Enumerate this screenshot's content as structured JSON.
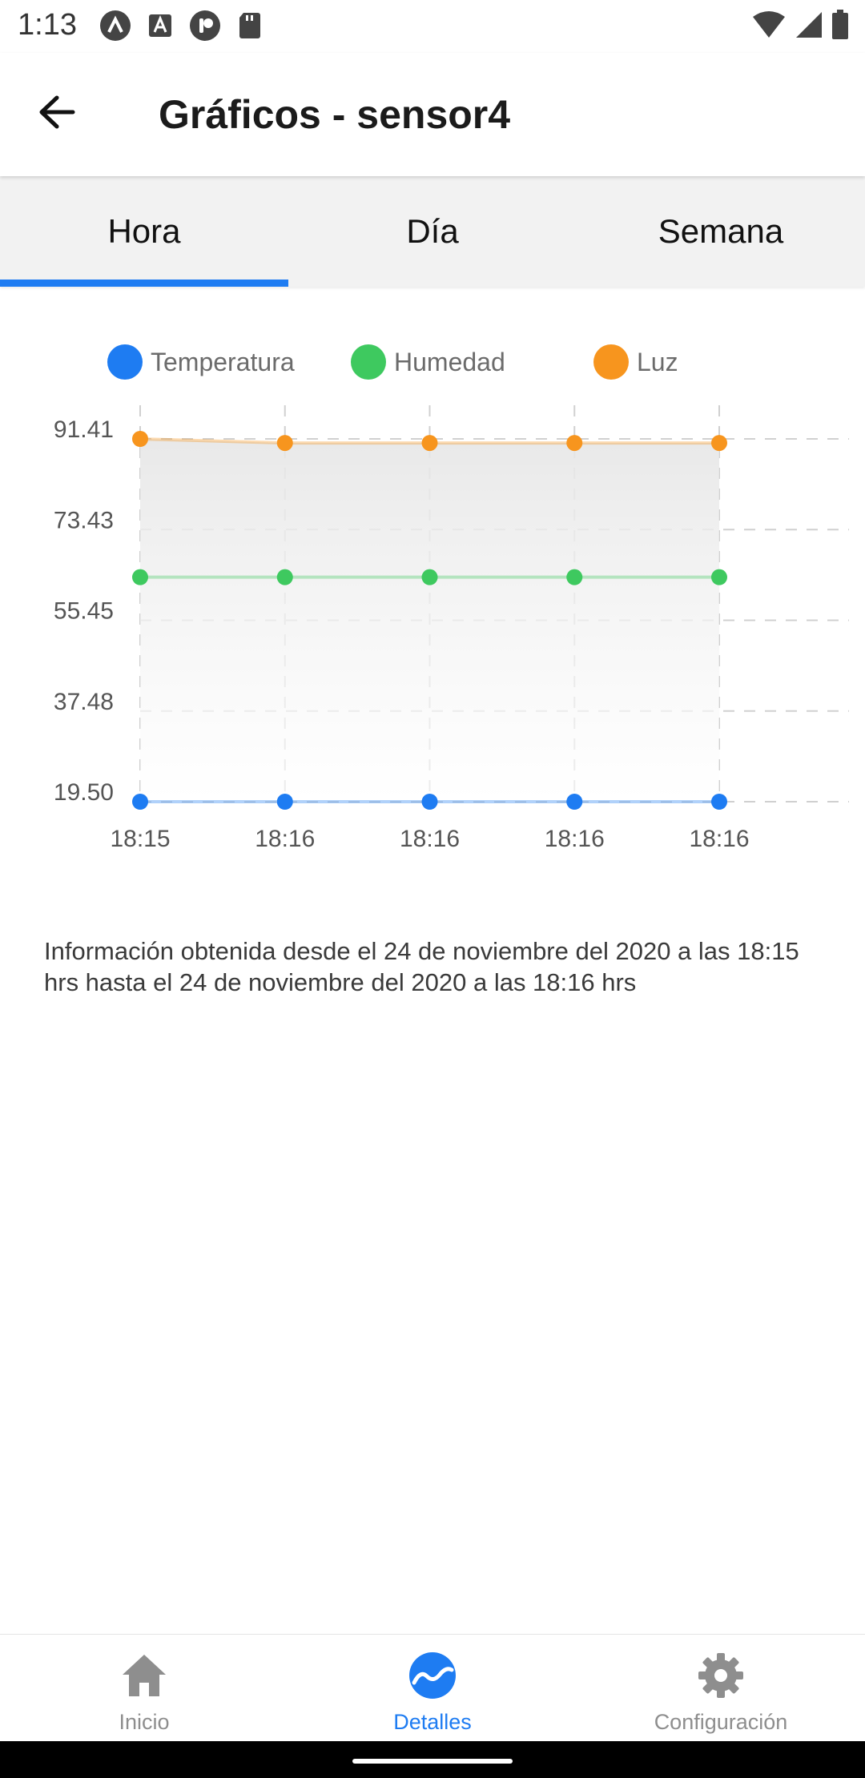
{
  "status_bar": {
    "time": "1:13"
  },
  "appbar": {
    "title": "Gráficos - sensor4"
  },
  "tabs": [
    {
      "label": "Hora",
      "active": true
    },
    {
      "label": "Día",
      "active": false
    },
    {
      "label": "Semana",
      "active": false
    }
  ],
  "chart_data": {
    "type": "line",
    "x": [
      "18:15",
      "18:16",
      "18:16",
      "18:16",
      "18:16"
    ],
    "yticks": [
      "91.41",
      "73.43",
      "55.45",
      "37.48",
      "19.50"
    ],
    "ylim": [
      19.5,
      91.41
    ],
    "grid": true,
    "legend_position": "top",
    "series": [
      {
        "name": "Temperatura",
        "color": "#1e7cf2",
        "values": [
          19.5,
          19.5,
          19.5,
          19.5,
          19.5
        ]
      },
      {
        "name": "Humedad",
        "color": "#3ec95f",
        "values": [
          64.0,
          64.0,
          64.0,
          64.0,
          64.0
        ]
      },
      {
        "name": "Luz",
        "color": "#f7951e",
        "values": [
          91.41,
          90.6,
          90.6,
          90.6,
          90.6
        ]
      }
    ]
  },
  "info_text": "Información obtenida desde el 24 de noviembre del 2020 a las 18:15 hrs hasta el 24 de noviembre del 2020 a las 18:16 hrs",
  "bottom_nav": [
    {
      "label": "Inicio",
      "icon": "home-icon",
      "active": false
    },
    {
      "label": "Detalles",
      "icon": "chart-wave-icon",
      "active": true
    },
    {
      "label": "Configuración",
      "icon": "gear-icon",
      "active": false
    }
  ],
  "colors": {
    "accent": "#1e7cf2",
    "temperatura": "#1e7cf2",
    "humedad": "#3ec95f",
    "luz": "#f7951e"
  }
}
